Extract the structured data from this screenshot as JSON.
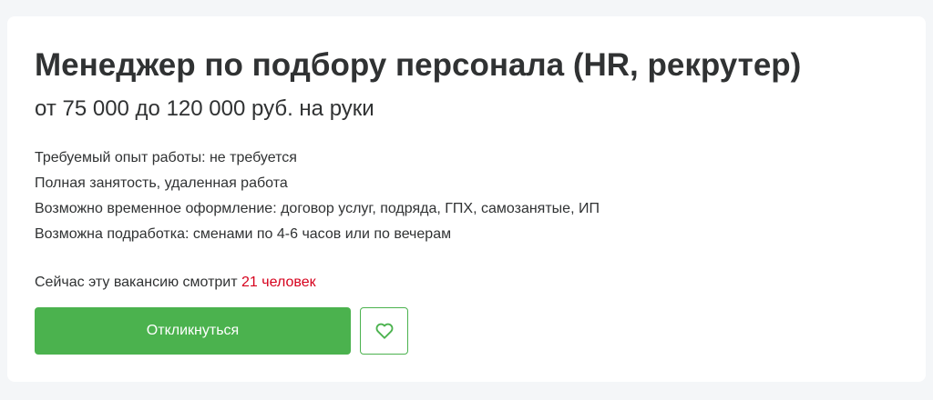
{
  "vacancy": {
    "title": "Менеджер по подбору персонала (HR, рекрутер)",
    "salary": "от 75 000 до 120 000 руб. на руки",
    "details": [
      "Требуемый опыт работы: не требуется",
      "Полная занятость, удаленная работа",
      "Возможно временное оформление: договор услуг, подряда, ГПХ, самозанятые, ИП",
      "Возможна подработка: сменами по 4-6 часов или по вечерам"
    ],
    "viewers_prefix": "Сейчас эту вакансию смотрит ",
    "viewers_count": "21 человек"
  },
  "actions": {
    "apply_label": "Откликнуться",
    "favorite_icon": "heart-outline-icon"
  },
  "colors": {
    "accent": "#4bb24e",
    "viewers_count": "#d6001c",
    "text": "#303233"
  }
}
